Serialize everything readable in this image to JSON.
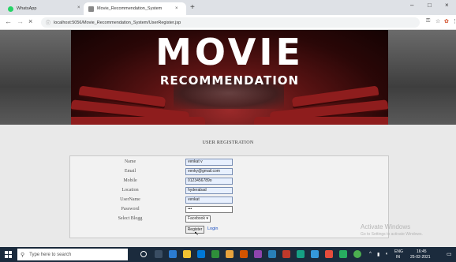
{
  "browser": {
    "tabs": [
      {
        "title": "WhatsApp",
        "close": "×",
        "favicon_color": "#25d366"
      },
      {
        "title": "Movie_Recommendation_System",
        "close": "×",
        "favicon_color": "#555555"
      }
    ],
    "new_tab": "+",
    "window_controls": {
      "minimize": "–",
      "maximize": "□",
      "close": "×"
    },
    "nav": {
      "back": "←",
      "forward": "→",
      "reload": "×"
    },
    "url": "localhost:5056/Movie_Recommendation_System/UserRegister.jsp"
  },
  "banner": {
    "title": "MOVIE",
    "subtitle": "RECOMMENDATION"
  },
  "form": {
    "heading": "USER REGISTRATION",
    "fields": [
      {
        "label": "Name",
        "value": "venkat v"
      },
      {
        "label": "Email",
        "value": "venky@gmail.com"
      },
      {
        "label": "Mobile",
        "value": "0123456789o"
      },
      {
        "label": "Location",
        "value": "hyderabad"
      },
      {
        "label": "UserName",
        "value": "venkat"
      },
      {
        "label": "Password",
        "value": "•••"
      }
    ],
    "blog": {
      "label": "Select Blogg",
      "selected": "Facebook ▾"
    },
    "register_label": "Register",
    "login_label": "Login"
  },
  "watermark": {
    "line1": "Activate Windows",
    "line2": "Go to Settings to activate Windows."
  },
  "taskbar": {
    "search_placeholder": "Type here to search",
    "tray_lang": "ENG",
    "tray_region": "IN",
    "time": "16:45",
    "date": "25-02-2021"
  },
  "colors": {
    "accent_red": "#8e1d1d",
    "link": "#1a4fc2",
    "taskbar": "#1b2b3d"
  }
}
